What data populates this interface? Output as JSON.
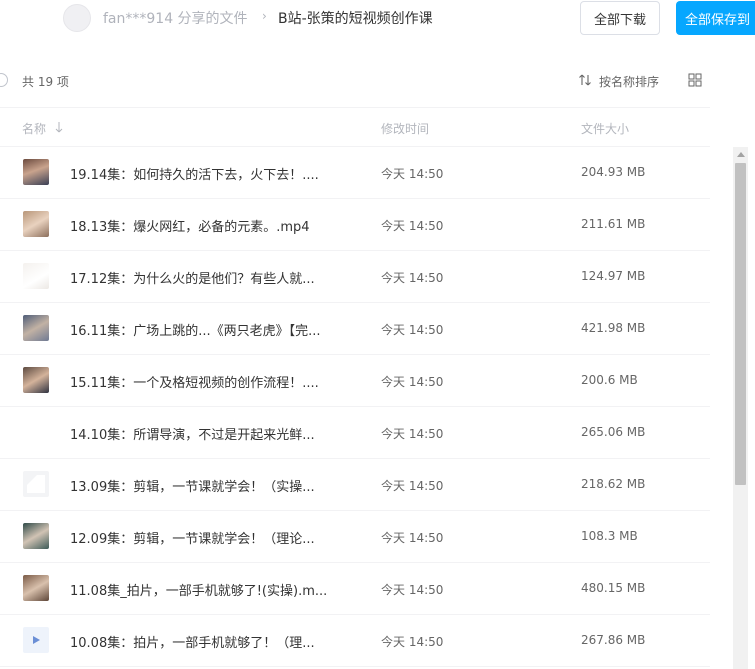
{
  "header": {
    "owner_text": "fan***914 分享的文件",
    "separator": "›",
    "current_folder": "B站-张策的短视频创作课",
    "download_all_label": "全部下载",
    "save_all_label": "全部保存到"
  },
  "toolbar": {
    "count_text": "共 19 项",
    "sort_label": "按名称排序"
  },
  "columns": {
    "name": "名称",
    "modified": "修改时间",
    "size": "文件大小"
  },
  "files": [
    {
      "name": "19.14集：如何持久的活下去，火下去！....",
      "modified": "今天 14:50",
      "size": "204.93 MB",
      "thumb": "t-dark"
    },
    {
      "name": "18.13集：爆火网红，必备的元素。.mp4",
      "modified": "今天 14:50",
      "size": "211.61 MB",
      "thumb": "t-warm"
    },
    {
      "name": "17.12集：为什么火的是他们？有些人就...",
      "modified": "今天 14:50",
      "size": "124.97 MB",
      "thumb": "t-faint"
    },
    {
      "name": "16.11集：广场上跳的...《两只老虎》【完...",
      "modified": "今天 14:50",
      "size": "421.98 MB",
      "thumb": "t-blue"
    },
    {
      "name": "15.11集：一个及格短视频的创作流程！....",
      "modified": "今天 14:50",
      "size": "200.6 MB",
      "thumb": "t-face"
    },
    {
      "name": "14.10集：所谓导演，不过是开起来光鲜...",
      "modified": "今天 14:50",
      "size": "265.06 MB",
      "thumb": "t-none"
    },
    {
      "name": "13.09集：剪辑，一节课就学会！（实操...",
      "modified": "今天 14:50",
      "size": "218.62 MB",
      "thumb": "t-doc"
    },
    {
      "name": "12.09集：剪辑，一节课就学会！（理论...",
      "modified": "今天 14:50",
      "size": "108.3 MB",
      "thumb": "t-green"
    },
    {
      "name": "11.08集_拍片，一部手机就够了!(实操).m...",
      "modified": "今天 14:50",
      "size": "480.15 MB",
      "thumb": "t-brown"
    },
    {
      "name": "10.08集：拍片，一部手机就够了！（理...",
      "modified": "今天 14:50",
      "size": "267.86 MB",
      "thumb": "t-video"
    }
  ],
  "colors": {
    "accent": "#06a7ff",
    "text_primary": "#333333",
    "text_muted": "#b3b6bd"
  },
  "icons": {
    "sort": "sort-arrows-icon",
    "grid": "grid-view-icon",
    "video": "video-play-icon"
  }
}
